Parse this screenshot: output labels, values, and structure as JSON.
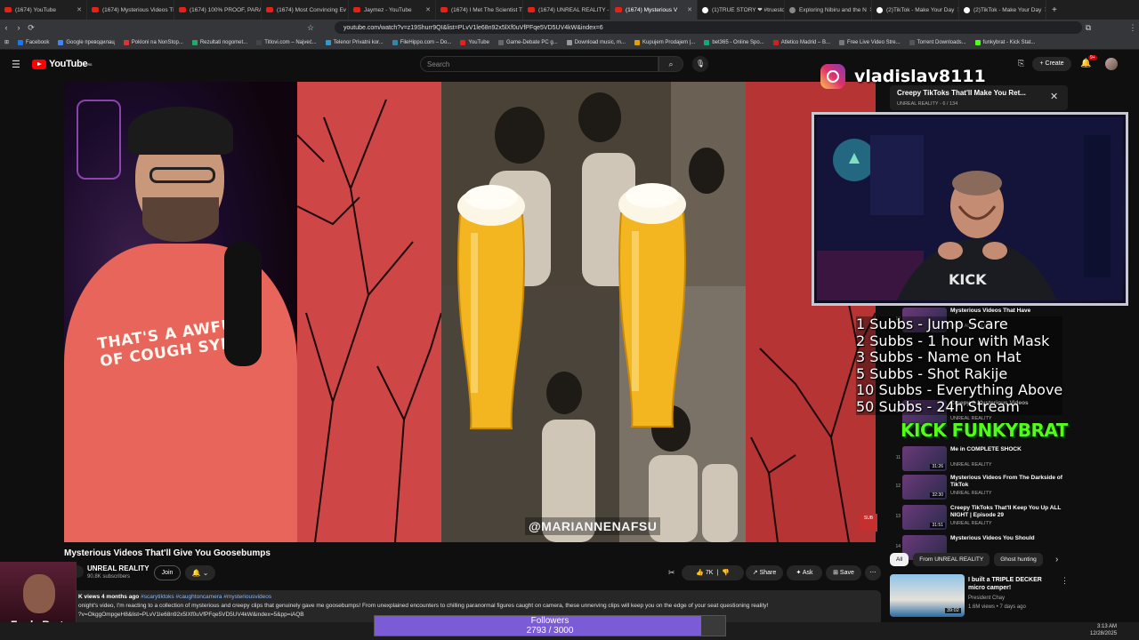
{
  "browser": {
    "tabs": [
      {
        "label": "(1674) YouTube",
        "icon": "youtube-icon"
      },
      {
        "label": "(1674) Mysterious Videos Th",
        "icon": "youtube-icon"
      },
      {
        "label": "(1674) 100% PROOF, PARA",
        "icon": "youtube-icon"
      },
      {
        "label": "(1674) Most Convincing Ev",
        "icon": "youtube-icon"
      },
      {
        "label": "Jaymez - YouTube",
        "icon": "youtube-icon"
      },
      {
        "label": "(1674) I Met The Scientist T",
        "icon": "youtube-icon"
      },
      {
        "label": "(1674) UNREAL REALITY - Y",
        "icon": "youtube-icon"
      },
      {
        "label": "(1674) Mysterious V",
        "icon": "youtube-icon",
        "active": true
      },
      {
        "label": "(1)TRUE STORY ❤ #truestor",
        "icon": "tiktok-icon"
      },
      {
        "label": "Exploring Nibiru and the N",
        "icon": "globe-icon"
      },
      {
        "label": "(2)TikTok - Make Your Day",
        "icon": "tiktok-icon"
      },
      {
        "label": "(2)TikTok - Make Your Day",
        "icon": "tiktok-icon"
      }
    ],
    "url": "youtube.com/watch?v=z19Shurr9QI&list=PLvV1le68n92x5lXf0uVfPFqe5VD5UV4kW&index=6",
    "bookmarks": [
      "Facebook",
      "Google преводилац",
      "Pokloni na NonStop...",
      "Rezultati nogomet...",
      "Titlovi.com – Najveć...",
      "Telenor Privatni kor...",
      "FileHippo.com – Do...",
      "YouTube",
      "Game-Debate PC g...",
      "Download music, m...",
      "Kupujem Prodajem |...",
      "bet365 - Online Spo...",
      "Atletico Madrid – B...",
      "Free Live Video Stre...",
      "Torrent Downloads...",
      "funkybrat - Kick Stat..."
    ]
  },
  "youtube": {
    "logo_text": "YouTube",
    "logo_sup": "RS",
    "search_placeholder": "Search",
    "create_label": "Create",
    "notif_count": "9+",
    "video_title": "Mysterious Videos That'll Give You Goosebumps",
    "channel_name": "UNREAL REALITY",
    "channel_subs": "90.8K subscribers",
    "join_label": "Join",
    "likes": "7K",
    "share_label": "Share",
    "ask_label": "Ask",
    "save_label": "Save",
    "desc_views": "K views  4 months ago ",
    "desc_tags": "#scarytiktoks #caughtoncamera #mysteriousvideos",
    "desc_text": "onight's video, I'm reacting to a collection of mysterious and creepy clips that genuinely gave me goosebumps! From unexplained encounters to chilling paranormal figures caught on camera, these unnerving clips will keep you on the edge of your seat questioning reality!",
    "desc_link": "?v=OkggOmpgeH8&list=PLvV1le68n92x5lXf0uVfPFqe5VD5UV4kW&index=5&pp=iAQB",
    "video_watermark": "@MARIANNENAFSU",
    "shirt_text": "THAT'S A AWFULL\nOF COUGH SYRUP",
    "miniplayer_title": "Creepy TikToks That'll Make You Ret...",
    "miniplayer_sub": "UNREAL REALITY - 6 / 134",
    "playlist": [
      {
        "num": "10",
        "title": "Mysterious Videos That Have",
        "channel": "UNREAL REALITY",
        "duration": ""
      },
      {
        "num": "11",
        "title": "Creepy & Mysterious Videos",
        "channel": "UNREAL REALITY",
        "duration": ""
      },
      {
        "num": "11",
        "title": "Me in COMPLETE SHOCK",
        "channel": "UNREAL REALITY",
        "duration": "31:26"
      },
      {
        "num": "12",
        "title": "Mysterious Videos From The Darkside of TikTok",
        "channel": "UNREAL REALITY",
        "duration": "32:30"
      },
      {
        "num": "13",
        "title": "Creepy TikToks That'll Keep You Up ALL NIGHT | Episode 29",
        "channel": "UNREAL REALITY",
        "duration": "31:51"
      },
      {
        "num": "14",
        "title": "Mysterious Videos You Should",
        "channel": "",
        "duration": ""
      }
    ],
    "chips": [
      "All",
      "From UNREAL REALITY",
      "Ghost hunting"
    ],
    "rec": {
      "title": "I built a TRIPLE DECKER micro camper!",
      "channel": "President Chay",
      "meta": "1.6M views • 7 days ago",
      "duration": "39:02"
    }
  },
  "overlay": {
    "ig_handle": "vladislav8111",
    "sub_goals": [
      "1 Subbs - Jump Scare",
      "2 Subbs - 1 hour with Mask",
      "3 Subbs - Name on Hat",
      "5 Subbs - Shot Rakije",
      "10 Subbs - Everything Above",
      "50 Subbs - 24h Stream"
    ],
    "kick_text": "KICK FUNKYBRAT",
    "streamer_name": "FunkyBrat",
    "followers_label": "Followers",
    "followers_current": 2793,
    "followers_goal": 3000,
    "followers_text": "2793 / 3000",
    "sub_button_text": "SUB"
  },
  "taskbar": {
    "time": "3:13 AM",
    "date": "12/28/2025"
  }
}
